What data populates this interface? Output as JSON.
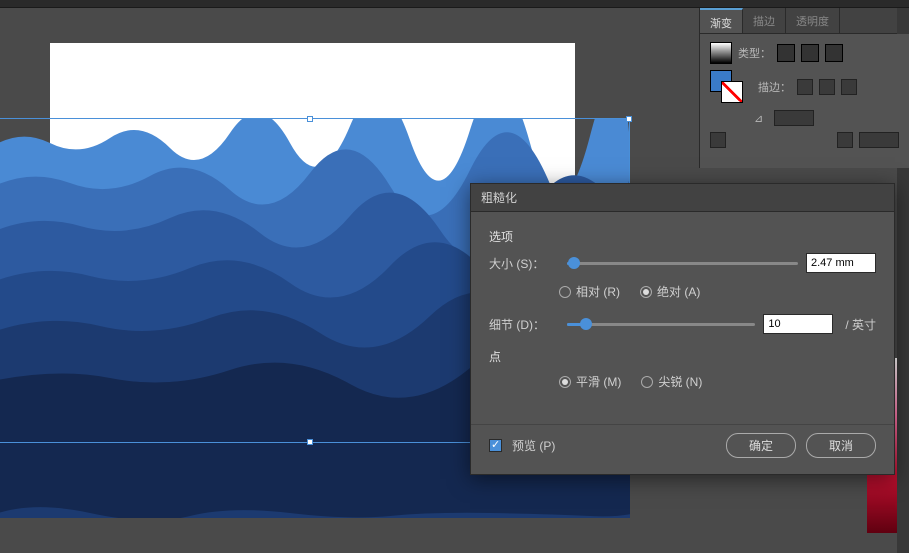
{
  "panel": {
    "tabs": {
      "gradient": "渐变",
      "stroke": "描边",
      "transparency": "透明度"
    },
    "type_label": "类型：",
    "stroke_label": "描边："
  },
  "dialog": {
    "title": "粗糙化",
    "options_label": "选项",
    "size_label": "大小 (S)：",
    "size_value": "2.47 mm",
    "size_pct": 3,
    "radio_relative": "相对 (R)",
    "radio_absolute": "绝对 (A)",
    "detail_label": "细节 (D)：",
    "detail_value": "10",
    "detail_pct": 10,
    "detail_unit": "/ 英寸",
    "points_label": "点",
    "radio_smooth": "平滑 (M)",
    "radio_corner": "尖锐 (N)",
    "preview_label": "预览 (P)",
    "ok": "确定",
    "cancel": "取消"
  },
  "artwork": {
    "colors": [
      "#4a8ad4",
      "#3a6fb8",
      "#2d5aa0",
      "#234a8a",
      "#1c3a70",
      "#142850"
    ]
  }
}
